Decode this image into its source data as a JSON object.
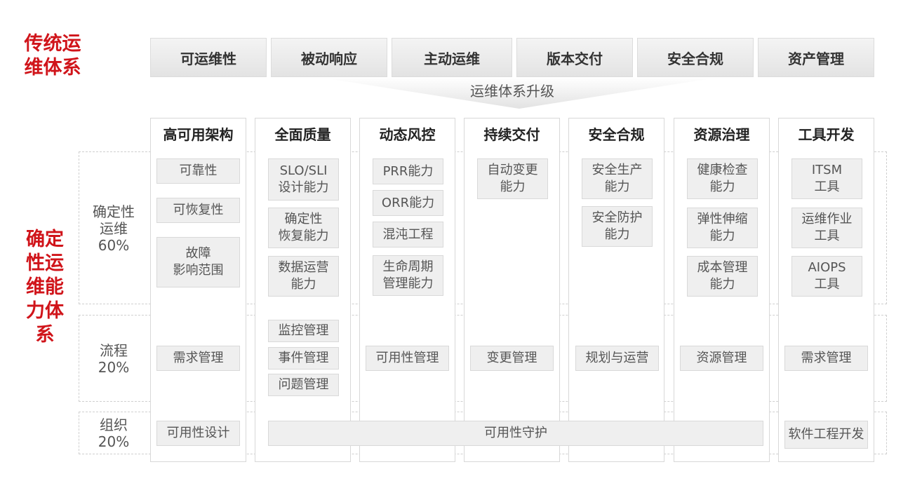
{
  "traditional_title": "传统运\n维体系",
  "deterministic_title": "确定\n性运\n维能\n力体\n系",
  "traditional_items": [
    "可运维性",
    "被动响应",
    "主动运维",
    "版本交付",
    "安全合规",
    "资产管理"
  ],
  "upgrade_label": "运维体系升级",
  "columns": [
    "高可用架构",
    "全面质量",
    "动态风控",
    "持续交付",
    "安全合规",
    "资源治理",
    "工具开发"
  ],
  "rows": {
    "deterministic": "确定性\n运维\n60%",
    "process": "流程\n20%",
    "org": "组织\n20%"
  },
  "cells": {
    "c0_det": [
      "可靠性",
      "可恢复性",
      "故障\n影响范围"
    ],
    "c1_det": [
      "SLO/SLI\n设计能力",
      "确定性\n恢复能力",
      "数据运营\n能力"
    ],
    "c2_det": [
      "PRR能力",
      "ORR能力",
      "混沌工程",
      "生命周期\n管理能力"
    ],
    "c3_det": [
      "自动变更\n能力"
    ],
    "c4_det": [
      "安全生产\n能力",
      "安全防护\n能力"
    ],
    "c5_det": [
      "健康检查\n能力",
      "弹性伸缩\n能力",
      "成本管理\n能力"
    ],
    "c6_det": [
      "ITSM\n工具",
      "运维作业\n工具",
      "AIOPS\n工具"
    ],
    "process": {
      "c0": "需求管理",
      "c1": [
        "监控管理",
        "事件管理",
        "问题管理"
      ],
      "c2": "可用性管理",
      "c3": "变更管理",
      "c4": "规划与运营",
      "c5": "资源管理",
      "c6": "需求管理"
    },
    "org": {
      "c0": "可用性设计",
      "span": "可用性守护",
      "c6": "软件工程开发"
    }
  }
}
